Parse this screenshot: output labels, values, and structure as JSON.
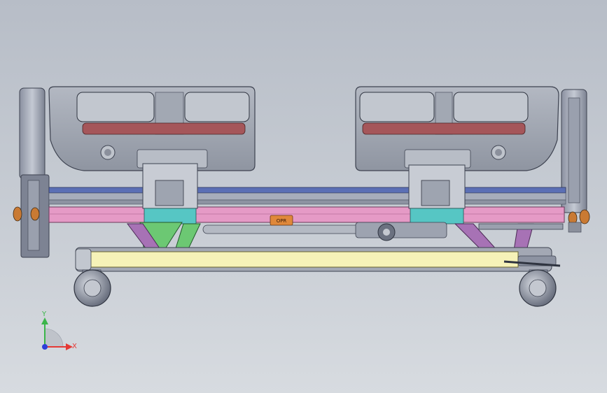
{
  "viewport": {
    "background_top": "#b9bfc8",
    "background_bottom": "#d6dade"
  },
  "model": {
    "part_colors": {
      "frame_pink": "#e59ac6",
      "bracket_cyan": "#56c6c4",
      "linkage_green": "#6cc873",
      "linkage_purple": "#a772b5",
      "base_yellow": "#f6f2b8",
      "rail_blue": "#5b6fb5",
      "motor_orange": "#e0883a",
      "panel_red": "#a5565a"
    },
    "motor_label": "OPR"
  },
  "triad": {
    "y_label": "Y",
    "x_label": "X",
    "y_color": "#3bb54a",
    "x_color": "#e53935",
    "z_color": "#2f3fd9"
  }
}
